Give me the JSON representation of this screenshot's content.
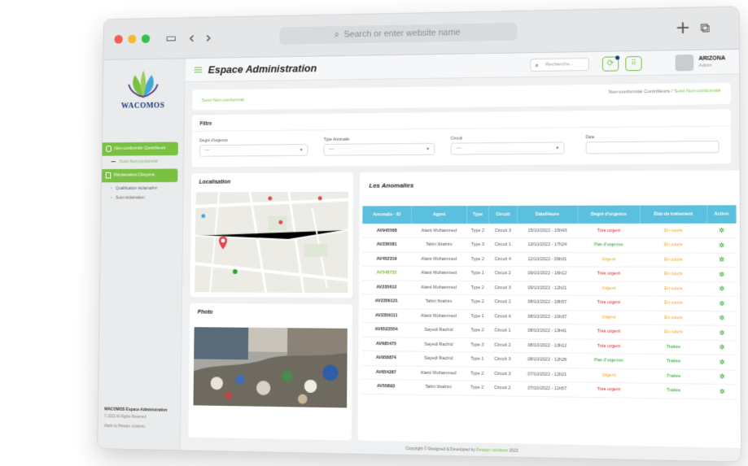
{
  "browser": {
    "address_placeholder": "Search or enter website name",
    "icons": [
      "back-icon",
      "forward-icon",
      "sidebar-toggle-icon",
      "new-tab-icon",
      "tabs-overview-icon",
      "search-icon"
    ]
  },
  "sidebar": {
    "logo_text": "WACOMOS",
    "items": [
      {
        "label": "Non-conformité Contrôleurs"
      },
      {
        "label": "Suivi Non-conformité"
      },
      {
        "label": "Réclamation Citoyens"
      },
      {
        "label": "Qualification réclamation"
      },
      {
        "label": "Suivi réclamation"
      }
    ],
    "footer_title": "WACOMOS Espace Administration",
    "footer_rights": "© 2022 All Rights Reserved",
    "footer_made": "Made by Reways solutions"
  },
  "header": {
    "title": "Espace Administration",
    "search_placeholder": "Recherche...",
    "user_name": "ARIZONA",
    "user_role": "Admin"
  },
  "breadcrumb": {
    "current": "Suivi Non-conformité",
    "path_parent": "Non-conformité Contrôleurs",
    "separator": "/",
    "path_active": "Suivi Non-conformité"
  },
  "filter": {
    "title": "Filtre",
    "fields": [
      {
        "label": "Degré d'urgence",
        "value": "---"
      },
      {
        "label": "Type Anomalie",
        "value": "---"
      },
      {
        "label": "Circuit",
        "value": "---"
      },
      {
        "label": "Date",
        "value": ""
      }
    ]
  },
  "localisation": {
    "title": "Localisation"
  },
  "photo": {
    "title": "Photo"
  },
  "anomalies": {
    "title": "Les Anomalies",
    "columns": [
      "Anomalie - ID",
      "Agent",
      "Type",
      "Circuit",
      "Date/Heure",
      "Degré d'urgence",
      "État de traitement",
      "Action"
    ],
    "rows": [
      {
        "id": "AV945568",
        "agent": "Alami Mohammed",
        "type": "Type 2",
        "circuit": "Circuit 3",
        "date": "15/10/2022 - 15h43",
        "urgence": "Très urgent",
        "etat": "En cours"
      },
      {
        "id": "AV236581",
        "agent": "Tahiri Ibrahim",
        "type": "Type 3",
        "circuit": "Circuit 1",
        "date": "13/10/2022 - 17h24",
        "urgence": "Pas d'urgence",
        "etat": "En cours"
      },
      {
        "id": "AV452319",
        "agent": "Alami Mohammed",
        "type": "Type 2",
        "circuit": "Circuit 4",
        "date": "12/10/2022 - 09h31",
        "urgence": "Urgent",
        "etat": "En cours"
      },
      {
        "id": "AV548722",
        "agent": "Alami Mohammed",
        "type": "Type 1",
        "circuit": "Circuit 2",
        "date": "09/10/2022 - 16h12",
        "urgence": "Très urgent",
        "etat": "En cours"
      },
      {
        "id": "AV235612",
        "agent": "Alami Mohammed",
        "type": "Type 2",
        "circuit": "Circuit 3",
        "date": "09/10/2022 - 12h21",
        "urgence": "Urgent",
        "etat": "En cours"
      },
      {
        "id": "AV2356121",
        "agent": "Tahiri Ibrahim",
        "type": "Type 2",
        "circuit": "Circuit 2",
        "date": "08/10/2022 - 18h57",
        "urgence": "Très urgent",
        "etat": "En cours"
      },
      {
        "id": "AV2356111",
        "agent": "Alami Mohammed",
        "type": "Type 1",
        "circuit": "Circuit 4",
        "date": "08/10/2022 - 10h37",
        "urgence": "Urgent",
        "etat": "En cours"
      },
      {
        "id": "AV6523554",
        "agent": "Sayedi Rachid",
        "type": "Type 2",
        "circuit": "Circuit 1",
        "date": "08/10/2022 - 13h41",
        "urgence": "Très urgent",
        "etat": "En cours"
      },
      {
        "id": "AV685475",
        "agent": "Sayedi Rachid",
        "type": "Type 3",
        "circuit": "Circuit 2",
        "date": "08/10/2022 - 13h12",
        "urgence": "Très urgent",
        "etat": "Traitée"
      },
      {
        "id": "AV958874",
        "agent": "Sayedi Rachid",
        "type": "Type 1",
        "circuit": "Circuit 3",
        "date": "08/10/2022 - 12h26",
        "urgence": "Pas d'urgence",
        "etat": "Traitée"
      },
      {
        "id": "AV654287",
        "agent": "Alami Mohammed",
        "type": "Type 2",
        "circuit": "Circuit 3",
        "date": "07/10/2022 - 12h21",
        "urgence": "Urgent",
        "etat": "Traitée"
      },
      {
        "id": "AV55893",
        "agent": "Tahiri Ibrahim",
        "type": "Type 2",
        "circuit": "Circuit 2",
        "date": "07/10/2022 - 11h57",
        "urgence": "Très urgent",
        "etat": "Traitée"
      }
    ]
  },
  "footer": {
    "copyright": "Copyright © Designed & Developed by",
    "brand": "Reways solutions",
    "year": "2022"
  },
  "colors": {
    "accent": "#7ac143",
    "table_header": "#5bc0de",
    "urgent": "#e02020",
    "warning": "#f0a020",
    "ok": "#2aa52a"
  }
}
